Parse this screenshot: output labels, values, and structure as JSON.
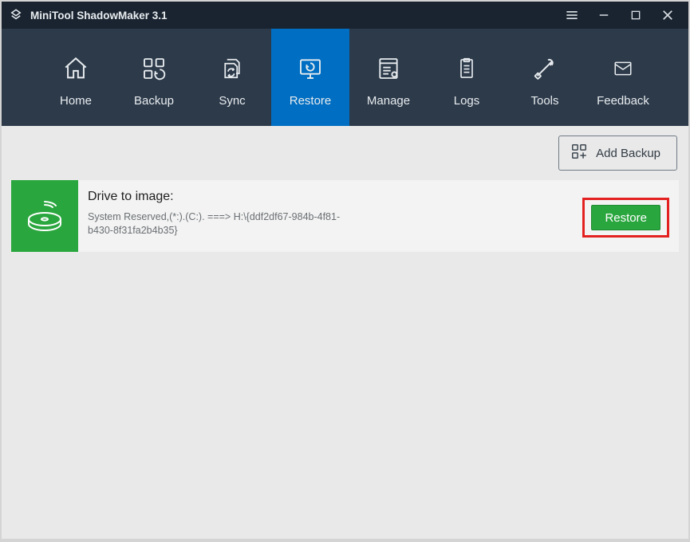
{
  "app": {
    "title": "MiniTool ShadowMaker 3.1"
  },
  "nav": {
    "items": [
      {
        "label": "Home"
      },
      {
        "label": "Backup"
      },
      {
        "label": "Sync"
      },
      {
        "label": "Restore"
      },
      {
        "label": "Manage"
      },
      {
        "label": "Logs"
      },
      {
        "label": "Tools"
      },
      {
        "label": "Feedback"
      }
    ]
  },
  "toolbar": {
    "add_backup_label": "Add Backup"
  },
  "entry": {
    "title": "Drive to image:",
    "detail": "System Reserved,(*:).(C:). ===> H:\\{ddf2df67-984b-4f81-b430-8f31fa2b4b35}",
    "restore_label": "Restore"
  }
}
